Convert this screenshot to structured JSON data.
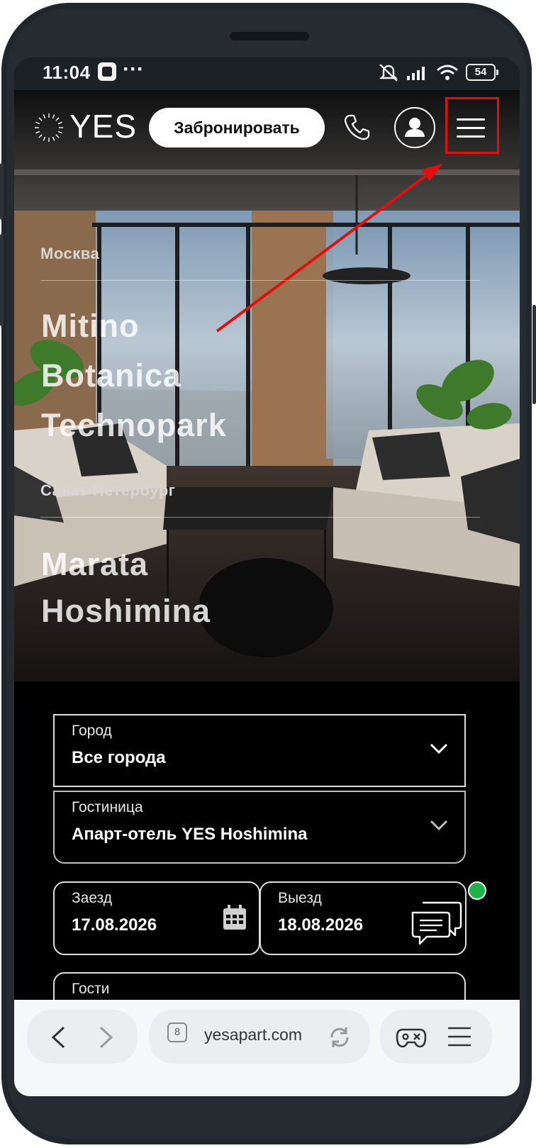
{
  "status_bar": {
    "time": "11:04",
    "more": "···",
    "battery": "54"
  },
  "header": {
    "logo": "YES",
    "book_label": "Забронировать"
  },
  "hero": {
    "cities": [
      {
        "name": "Москва",
        "hotels": [
          "Mitino",
          "Botanica",
          "Technopark"
        ]
      },
      {
        "name": "Санкт-Петербург",
        "hotels": [
          "Marata",
          "Hoshimina"
        ]
      }
    ]
  },
  "booking_form": {
    "city": {
      "label": "Город",
      "value": "Все города"
    },
    "hotel": {
      "label": "Гостиница",
      "value": "Апарт-отель YES Hoshimina"
    },
    "checkin": {
      "label": "Заезд",
      "value": "17.08.2026"
    },
    "checkout": {
      "label": "Выезд",
      "value": "18.08.2026"
    },
    "guests": {
      "label": "Гости"
    }
  },
  "browser": {
    "tab_count": "8",
    "url": "yesapart.com"
  },
  "colors": {
    "accent_highlight": "#e01010",
    "online_dot": "#1db34a"
  }
}
